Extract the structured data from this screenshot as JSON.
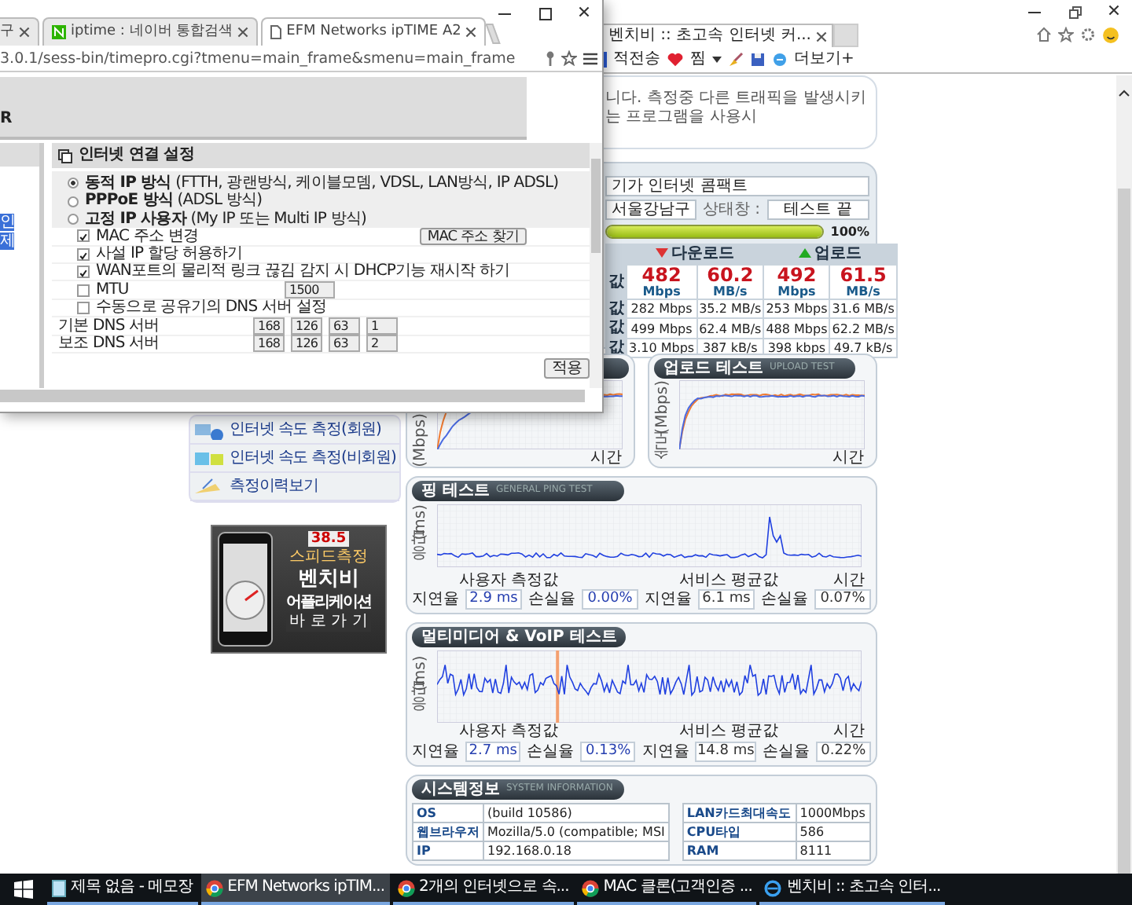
{
  "chrome_window": {
    "tabs": [
      {
        "label": "구",
        "selected": false
      },
      {
        "label": "iptime : 네이버 통합검색",
        "selected": false
      },
      {
        "label": "EFM Networks ipTIME A2",
        "selected": true
      }
    ],
    "address": "3.0.1/sess-bin/timepro.cgi?tmenu=main_frame&smenu=main_frame",
    "header_text": "R",
    "sidebar_selection": [
      "인",
      "제"
    ],
    "panel_title": "인터넷 연결 설정",
    "connection_types": [
      {
        "label": "**동적 IP 방식** (FTTH, 광랜방식, 케이블모뎀, VDSL, LAN방식, IP ADSL)",
        "selected": true
      },
      {
        "label": "**PPPoE 방식** (ADSL 방식)",
        "selected": false
      },
      {
        "label": "**고정 IP 사용자** (My IP 또는 Multi IP 방식)",
        "selected": false
      }
    ],
    "options": [
      {
        "kind": "checkbox",
        "label": "MAC 주소 변경",
        "checked": true,
        "button": "MAC 주소 찾기"
      },
      {
        "kind": "checkbox",
        "label": "사설 IP 할당 허용하기",
        "checked": true
      },
      {
        "kind": "checkbox",
        "label": "WAN포트의 물리적 링크 끊김 감지 시 DHCP기능 재시작 하기",
        "checked": true
      },
      {
        "kind": "checkbox",
        "label": "MTU",
        "checked": false,
        "value": "1500"
      },
      {
        "kind": "checkbox",
        "label": "수동으로 공유기의 DNS 서버 설정",
        "checked": false
      },
      {
        "kind": "dns",
        "label": "기본 DNS 서버",
        "octets": [
          "168",
          "126",
          "63",
          "1"
        ]
      },
      {
        "kind": "dns",
        "label": "보조 DNS 서버",
        "octets": [
          "168",
          "126",
          "63",
          "2"
        ]
      }
    ],
    "apply_button": "적용"
  },
  "ie_window": {
    "tab": "벤치비 :: 초고속 인터넷 커...",
    "favorites": [
      "적전송",
      "찜",
      "더보기+"
    ],
    "notice": "니다. 측정중 다른 트래픽을 발생시키는 프로그램을 사용시",
    "product": "기가 인터넷 콤팩트",
    "region": "서울강남구",
    "status_label": "상태창 :",
    "status": "테스트 끝",
    "progress": {
      "level": 1,
      "reading": "100%"
    },
    "results": {
      "download_label": "다운로드",
      "upload_label": "업로드",
      "best": {
        "label": "값",
        "cells": [
          {
            "value": "482",
            "unit": "Mbps"
          },
          {
            "value": "60.2",
            "unit": "MB/s"
          },
          {
            "value": "492",
            "unit": "Mbps"
          },
          {
            "value": "61.5",
            "unit": "MB/s"
          }
        ]
      },
      "rows": [
        {
          "label": "값",
          "cells": [
            "282 Mbps",
            "35.2 MB/s",
            "253 Mbps",
            "31.6 MB/s"
          ]
        },
        {
          "label": "값",
          "cells": [
            "499 Mbps",
            "62.4 MB/s",
            "488 Mbps",
            "62.2 MB/s"
          ]
        },
        {
          "label": "값",
          "cells": [
            "3.10 Mbps",
            "387 kB/s",
            "398 kbps",
            "49.7 kB/s"
          ]
        }
      ]
    },
    "speed_tests": [
      {
        "ylabel": "(Mbps)",
        "xlabel": "시간"
      },
      {
        "title": "업로드 테스트",
        "subtitle": "UPLOAD TEST",
        "ylabel": "속도 (Mbps)",
        "xlabel": "시간"
      }
    ],
    "quality_tests": [
      {
        "title": "핑 테스트",
        "subtitle": "GENERAL PING TEST",
        "ylabel": "응답(ms)",
        "xlabel": "시간",
        "user": {
          "caption": "사용자 측정값",
          "latency_label": "지연율",
          "latency": "2.9 ms",
          "loss_label": "손실율",
          "loss": "0.00%"
        },
        "service": {
          "caption": "서비스 평균값",
          "latency_label": "지연율",
          "latency": "6.1 ms",
          "loss_label": "손실율",
          "loss": "0.07%"
        }
      },
      {
        "title": "멀티미디어 & VoIP 테스트",
        "ylabel": "응답(ms)",
        "xlabel": "시간",
        "user": {
          "caption": "사용자 측정값",
          "latency_label": "지연율",
          "latency": "2.7 ms",
          "loss_label": "손실율",
          "loss": "0.13%"
        },
        "service": {
          "caption": "서비스 평균값",
          "latency_label": "지연율",
          "latency": "14.8 ms",
          "loss_label": "손실율",
          "loss": "0.22%"
        }
      }
    ],
    "system_info": {
      "title": "시스템정보",
      "subtitle": "SYSTEM INFORMATION",
      "left": [
        {
          "label": "OS",
          "value": "(build 10586)"
        },
        {
          "label": "웹브라우저",
          "value": "Mozilla/5.0 (compatible; MSI"
        },
        {
          "label": "IP",
          "value": "192.168.0.18"
        }
      ],
      "right": [
        {
          "label": "LAN카드최대속도",
          "value": "1000Mbps"
        },
        {
          "label": "CPU타입",
          "value": "586"
        },
        {
          "label": "RAM",
          "value": "8111"
        }
      ]
    },
    "sidebar_menu": [
      "인터넷 속도 측정(회원)",
      "인터넷 속도 측정(비회원)",
      "측정이력보기"
    ],
    "banner": {
      "reading": "38.5",
      "tag": "스피드측정",
      "title": "벤치비",
      "subtitle": "어플리케이션",
      "link": "바 로 가 기"
    }
  },
  "taskbar": [
    {
      "label": "제목 없음 - 메모장",
      "selected": false
    },
    {
      "label": "EFM Networks ipTIM...",
      "selected": true
    },
    {
      "label": "2개의 인터넷으로 속...",
      "selected": false
    },
    {
      "label": "MAC 클론(고객인증 ...",
      "selected": false
    },
    {
      "label": "벤치비 :: 초고속 인터...",
      "selected": false
    }
  ]
}
